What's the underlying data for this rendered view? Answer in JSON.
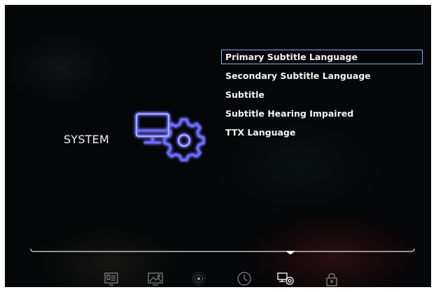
{
  "category": {
    "label": "SYSTEM",
    "icon": "system-settings-icon"
  },
  "menu": {
    "items": [
      {
        "label": "Primary Subtitle Language",
        "selected": true
      },
      {
        "label": "Secondary Subtitle Language",
        "selected": false
      },
      {
        "label": "Subtitle",
        "selected": false
      },
      {
        "label": "Subtitle Hearing Impaired",
        "selected": false
      },
      {
        "label": "TTX Language",
        "selected": false
      }
    ]
  },
  "tabbar": {
    "tabs": [
      {
        "icon": "tv-source-icon",
        "active": false
      },
      {
        "icon": "picture-icon",
        "active": false
      },
      {
        "icon": "sound-icon",
        "active": false
      },
      {
        "icon": "clock-icon",
        "active": false
      },
      {
        "icon": "system-settings-icon",
        "active": true
      },
      {
        "icon": "lock-icon",
        "active": false
      }
    ]
  },
  "colors": {
    "accent_glow": "#3b3bff",
    "selection_border": "#7fb4ee",
    "text": "#f4f4f4"
  }
}
